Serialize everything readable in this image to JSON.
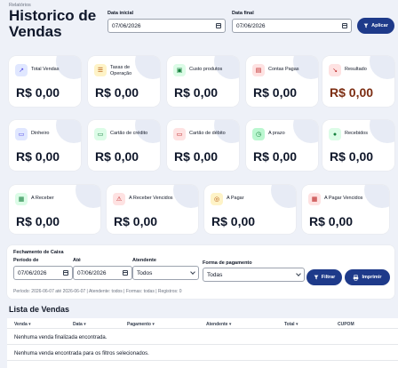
{
  "header": {
    "breadcrumb": "Relatórios",
    "title": "Historico de Vendas",
    "start_label": "Data inicial",
    "start_value": "07/06/2026",
    "end_label": "Data final",
    "end_value": "07/06/2026",
    "apply_label": "Aplicar"
  },
  "cards": [
    {
      "label": "Total Vendas",
      "value": "R$ 0,00",
      "icon": "chart-up-icon",
      "icon_bg": "#e0e7ff",
      "icon_color": "#4f46e5",
      "value_color": "#0f172a"
    },
    {
      "label": "Taxas de Operação",
      "value": "R$ 0,00",
      "icon": "receipt-icon",
      "icon_bg": "#fef3c7",
      "icon_color": "#b45309",
      "value_color": "#0f172a"
    },
    {
      "label": "Custo produtos",
      "value": "R$ 0,00",
      "icon": "box-icon",
      "icon_bg": "#dcfce7",
      "icon_color": "#15803d",
      "value_color": "#0f172a"
    },
    {
      "label": "Contas Pagas",
      "value": "R$ 0,00",
      "icon": "document-icon",
      "icon_bg": "#fee2e2",
      "icon_color": "#b91c1c",
      "value_color": "#0f172a"
    },
    {
      "label": "Resultado",
      "value": "R$ 0,00",
      "icon": "trend-icon",
      "icon_bg": "#fee2e2",
      "icon_color": "#b91c1c",
      "value_color": "#7c2d12"
    },
    {
      "label": "Dinheiro",
      "value": "R$ 0,00",
      "icon": "cash-icon",
      "icon_bg": "#e0e7ff",
      "icon_color": "#4f46e5",
      "value_color": "#0f172a"
    },
    {
      "label": "Cartão de crédito",
      "value": "R$ 0,00",
      "icon": "credit-card-icon",
      "icon_bg": "#dcfce7",
      "icon_color": "#15803d",
      "value_color": "#0f172a"
    },
    {
      "label": "Cartão de débito",
      "value": "R$ 0,00",
      "icon": "debit-card-icon",
      "icon_bg": "#fee2e2",
      "icon_color": "#b91c1c",
      "value_color": "#0f172a"
    },
    {
      "label": "A prazo",
      "value": "R$ 0,00",
      "icon": "clock-icon",
      "icon_bg": "#bbf7d0",
      "icon_color": "#15803d",
      "value_color": "#0f172a"
    },
    {
      "label": "Recebidos",
      "value": "R$ 0,00",
      "icon": "piggy-bank-icon",
      "icon_bg": "#dcfce7",
      "icon_color": "#15803d",
      "value_color": "#0f172a"
    },
    {
      "label": "A Receber",
      "value": "R$ 0,00",
      "icon": "calendar-receive-icon",
      "icon_bg": "#dcfce7",
      "icon_color": "#15803d",
      "value_color": "#0f172a"
    },
    {
      "label": "A Receber Vencidos",
      "value": "R$ 0,00",
      "icon": "warning-icon",
      "icon_bg": "#fee2e2",
      "icon_color": "#b91c1c",
      "value_color": "#0f172a"
    },
    {
      "label": "A Pagar",
      "value": "R$ 0,00",
      "icon": "coins-icon",
      "icon_bg": "#fef3c7",
      "icon_color": "#b45309",
      "value_color": "#0f172a"
    },
    {
      "label": "A Pagar Vencidos",
      "value": "R$ 0,00",
      "icon": "calendar-alert-icon",
      "icon_bg": "#fee2e2",
      "icon_color": "#b91c1c",
      "value_color": "#0f172a"
    }
  ],
  "closing": {
    "title": "Fechamento de Caixa",
    "from_label": "Período de",
    "from_value": "07/06/2026",
    "to_label": "Até",
    "to_value": "07/06/2026",
    "attendant_label": "Atendente",
    "attendant_value": "Todos",
    "payment_label": "Forma de pagamento",
    "payment_value": "Todas",
    "filter_label": "Filtrar",
    "print_label": "Imprimir",
    "summary": "Período: 2026-06-07 até 2026-06-07 | Atendente: todos | Formas: todas | Registros: 0"
  },
  "sales": {
    "title": "Lista de Vendas",
    "columns": [
      "Venda ▾",
      "Data ▾",
      "Pagamento ▾",
      "Atendente ▾",
      "Total ▾",
      "CUPOM"
    ],
    "rows": [
      "Nenhuma venda finalizada encontrada.",
      "Nenhuma venda encontrada para os filtros selecionados."
    ]
  },
  "colors": {
    "primary": "#1e3a8a",
    "background": "#eef1f8"
  }
}
